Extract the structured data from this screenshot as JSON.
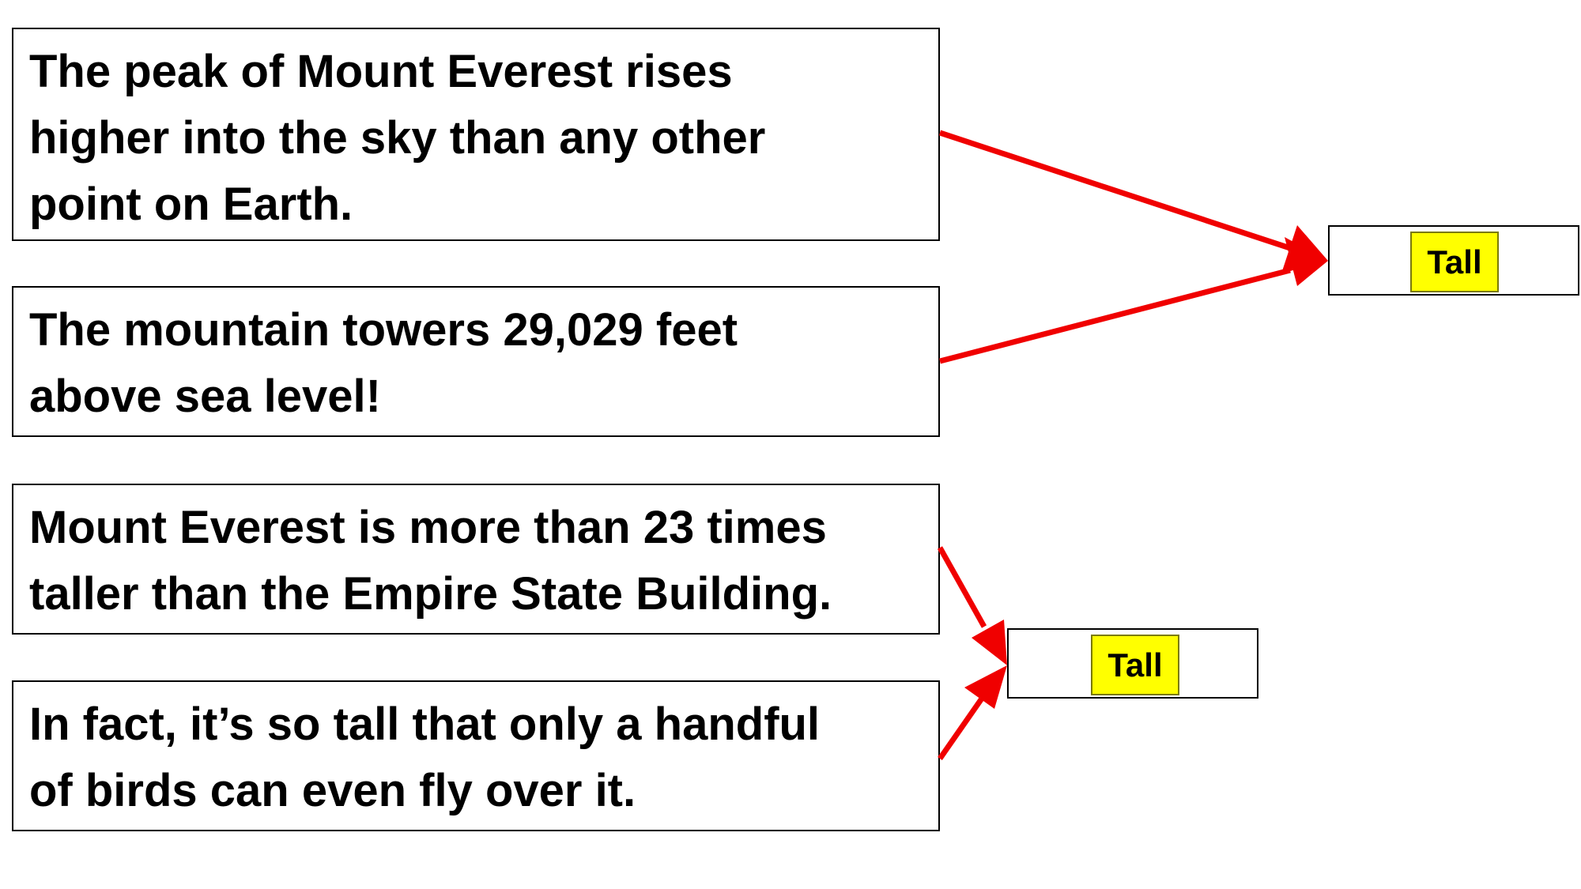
{
  "statements": [
    {
      "lines": [
        "The peak of Mount Everest rises",
        "higher into the sky than any other",
        "point on Earth."
      ]
    },
    {
      "lines": [
        "The mountain towers 29,029 feet",
        "above sea level!"
      ]
    },
    {
      "lines": [
        "Mount Everest is more than 23 times",
        "taller than the Empire State Building."
      ]
    },
    {
      "lines": [
        "In fact, it’s so tall that only a handful",
        "of birds can even fly over it."
      ]
    }
  ],
  "labels": [
    {
      "text": "Tall"
    },
    {
      "text": "Tall"
    }
  ],
  "colors": {
    "arrow": "#f00000",
    "label_highlight": "#ffff00",
    "border": "#000000"
  }
}
